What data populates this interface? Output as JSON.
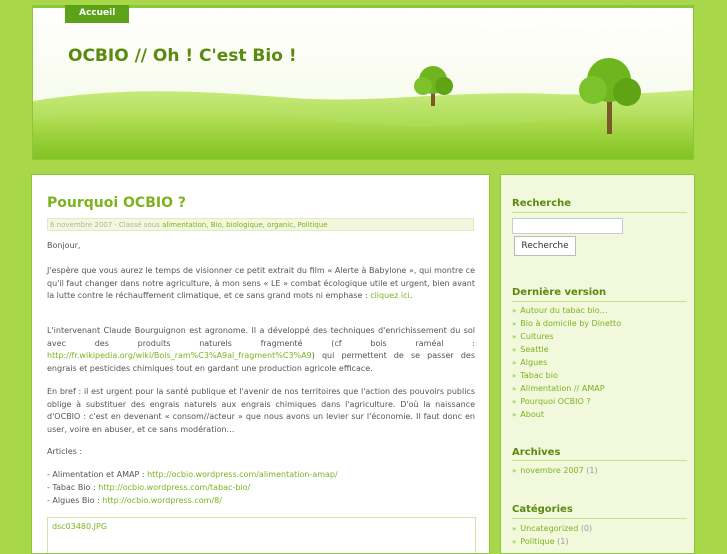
{
  "nav": {
    "items": [
      {
        "label": "Accueil"
      },
      {
        "label": "About"
      },
      {
        "label": "Alimentation // AMAP"
      },
      {
        "label": "Tabac bio"
      },
      {
        "label": "Algues"
      },
      {
        "label": "Seattle"
      },
      {
        "label": "Cultures"
      },
      {
        "label": "Bio à domicile"
      }
    ],
    "seattle_line2": "by Dinetto",
    "bio_line2": "Autour du tabac bio…"
  },
  "site": {
    "title": "OCBIO // Oh ! C'est Bio !"
  },
  "post": {
    "title": "Pourquoi OCBIO ?",
    "meta_prefix": "6 novembre 2007 · Classé sous",
    "meta_categories": "alimentation, Bio, biologique, organic, Politique",
    "greeting": "Bonjour,",
    "p1_text": "J'espère que vous aurez le temps de visionner ce petit extrait du film « Alerte à Babylone », qui montre ce qu'il faut changer dans notre agriculture, à mon sens « LE » combat écologique utile et urgent, bien avant la lutte contre le réchauffement climatique, et ce sans grand mots ni emphase :",
    "p1_link": "cliquez ici",
    "p2_text": "L'intervenant Claude Bourguignon est agronome. Il a développé des techniques d'enrichissement du sol avec des produits naturels fragmenté (cf bois raméal :",
    "p2_link": "http://fr.wikipedia.org/wiki/Bois_ram%C3%A9al_fragment%C3%A9",
    "p2_tail": ") qui permettent de se passer des engrais et pesticides chimiques tout en gardant une production agricole efficace.",
    "p3": "En bref : il est urgent pour la santé publique et l'avenir de nos territoires que l'action des pouvoirs publics oblige à substituer des engrais naturels aux engrais chimiques dans l'agriculture. D'où la naissance d'OCBIO : c'est en devenant « consom//acteur » que nous avons un levier sur l'économie. Il faut donc en user, voire en abuser, et ce sans modération…",
    "articles_label": "Articles :",
    "articles": [
      {
        "label": "- Alimentation et AMAP : ",
        "url": "http://ocbio.wordpress.com/alimentation-amap/"
      },
      {
        "label": "- Tabac Bio : ",
        "url": "http://ocbio.wordpress.com/tabac-bio/"
      },
      {
        "label": "- Algues Bio :  ",
        "url": "http://ocbio.wordpress.com/8/"
      }
    ],
    "image_caption": "dsc03480.JPG"
  },
  "sidebar": {
    "search_heading": "Recherche",
    "search_button": "Recherche",
    "recent_heading": "Dernière version",
    "recent_items": [
      "Autour du tabac bio…",
      "Bio à domicile by Dinetto",
      "Cultures",
      "Seattle",
      "Algues",
      "Tabac bio",
      "Alimentation // AMAP",
      "Pourquoi OCBIO ?",
      "About"
    ],
    "archives_heading": "Archives",
    "archives": [
      {
        "label": "novembre 2007",
        "count": "(1)"
      }
    ],
    "categories_heading": "Catégories",
    "categories": [
      {
        "label": "Uncategorized",
        "count": "(0)"
      },
      {
        "label": "Politique",
        "count": "(1)"
      }
    ]
  }
}
